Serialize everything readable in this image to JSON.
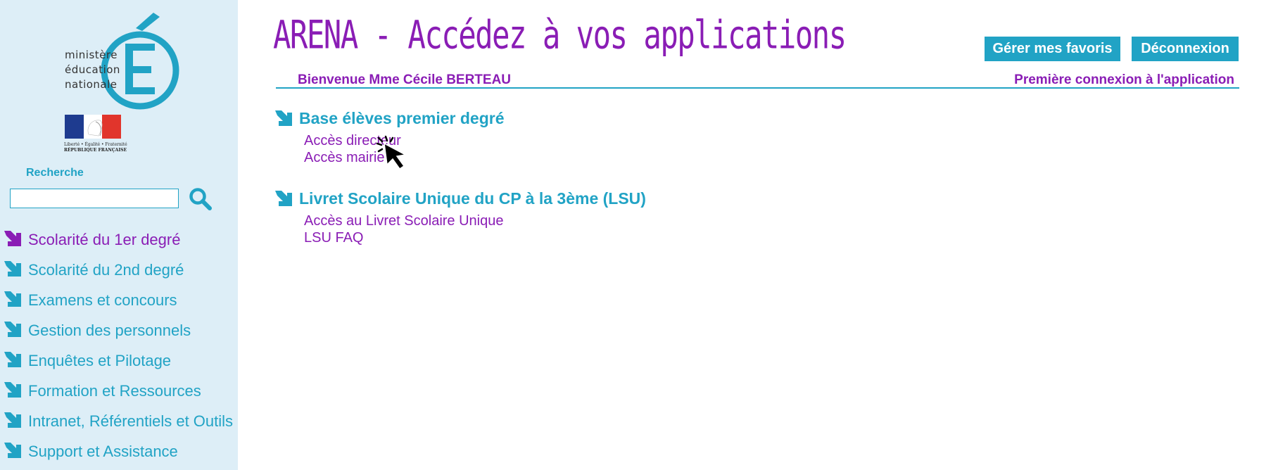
{
  "brand": {
    "ministry_lines": [
      "ministère",
      "éducation",
      "nationale"
    ],
    "letter": "É",
    "marianne_caption_line1": "Liberté • Égalité • Fraternité",
    "marianne_caption_line2": "RÉPUBLIQUE FRANÇAISE"
  },
  "search": {
    "label": "Recherche",
    "value": "",
    "placeholder": ""
  },
  "sidebar": {
    "items": [
      {
        "label": "Scolarité du 1er degré",
        "active": true
      },
      {
        "label": "Scolarité du 2nd degré",
        "active": false
      },
      {
        "label": "Examens et concours",
        "active": false
      },
      {
        "label": "Gestion des personnels",
        "active": false
      },
      {
        "label": "Enquêtes et Pilotage",
        "active": false
      },
      {
        "label": "Formation et Ressources",
        "active": false
      },
      {
        "label": "Intranet, Référentiels et Outils",
        "active": false
      },
      {
        "label": "Support et Assistance",
        "active": false
      }
    ]
  },
  "header": {
    "title": "ARENA - Accédez à vos applications",
    "favorites_button": "Gérer mes favoris",
    "logout_button": "Déconnexion",
    "welcome": "Bienvenue Mme Cécile BERTEAU",
    "first_connection": "Première connexion à l'application"
  },
  "sections": [
    {
      "title": "Base élèves premier degré",
      "links": [
        "Accès directeur",
        "Accès mairie"
      ]
    },
    {
      "title": "Livret Scolaire Unique du CP à la 3ème (LSU)",
      "links": [
        "Accès au Livret Scolaire Unique",
        "LSU FAQ"
      ]
    }
  ],
  "colors": {
    "accent_blue": "#21a3c5",
    "accent_purple": "#8a1db5",
    "sidebar_bg": "#ddeef7"
  }
}
